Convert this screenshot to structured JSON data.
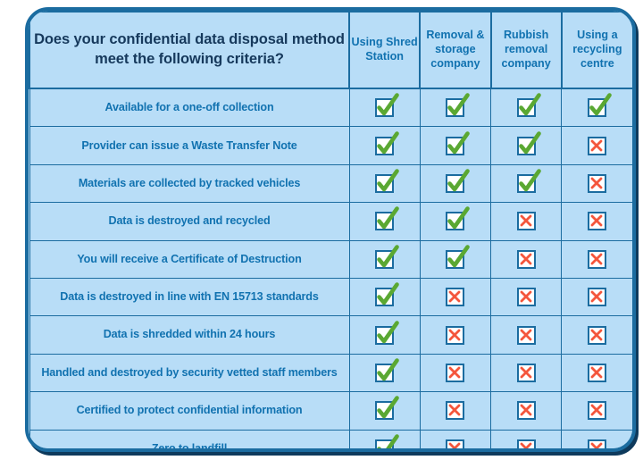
{
  "table": {
    "title": "Does your confidential data disposal method meet the following criteria?",
    "columns": [
      {
        "label": "Using Shred Station",
        "name": "using-shred-station"
      },
      {
        "label": "Removal & storage company",
        "name": "removal-storage-company"
      },
      {
        "label": "Rubbish removal company",
        "name": "rubbish-removal-company"
      },
      {
        "label": "Using a recycling centre",
        "name": "using-recycling-centre"
      }
    ],
    "rows": [
      {
        "label": "Available for a one-off collection",
        "values": [
          "tick",
          "tick",
          "tick",
          "tick"
        ]
      },
      {
        "label": "Provider can issue a Waste Transfer Note",
        "values": [
          "tick",
          "tick",
          "tick",
          "cross"
        ]
      },
      {
        "label": "Materials are collected by tracked vehicles",
        "values": [
          "tick",
          "tick",
          "tick",
          "cross"
        ]
      },
      {
        "label": "Data is destroyed and recycled",
        "values": [
          "tick",
          "tick",
          "cross",
          "cross"
        ]
      },
      {
        "label": "You will receive a Certificate of Destruction",
        "values": [
          "tick",
          "tick",
          "cross",
          "cross"
        ]
      },
      {
        "label": "Data is destroyed in line with EN 15713 standards",
        "values": [
          "tick",
          "cross",
          "cross",
          "cross"
        ]
      },
      {
        "label": "Data is shredded within 24 hours",
        "values": [
          "tick",
          "cross",
          "cross",
          "cross"
        ]
      },
      {
        "label": "Handled and destroyed by security vetted staff members",
        "values": [
          "tick",
          "cross",
          "cross",
          "cross"
        ]
      },
      {
        "label": "Certified to protect confidential information",
        "values": [
          "tick",
          "cross",
          "cross",
          "cross"
        ]
      },
      {
        "label": "Zero to landfill",
        "values": [
          "tick",
          "cross",
          "cross",
          "cross"
        ]
      }
    ],
    "icons": {
      "tick": "check-tick-icon",
      "cross": "cross-x-icon"
    },
    "colors": {
      "panel_background": "#b8ddf7",
      "border": "#1b6ca0",
      "shadow": "#0e3a5c",
      "title_text": "#16395c",
      "label_text": "#1172b0",
      "tick": "#5aa832",
      "cross": "#f4563c",
      "mark_box_fill": "#ffffff"
    }
  }
}
